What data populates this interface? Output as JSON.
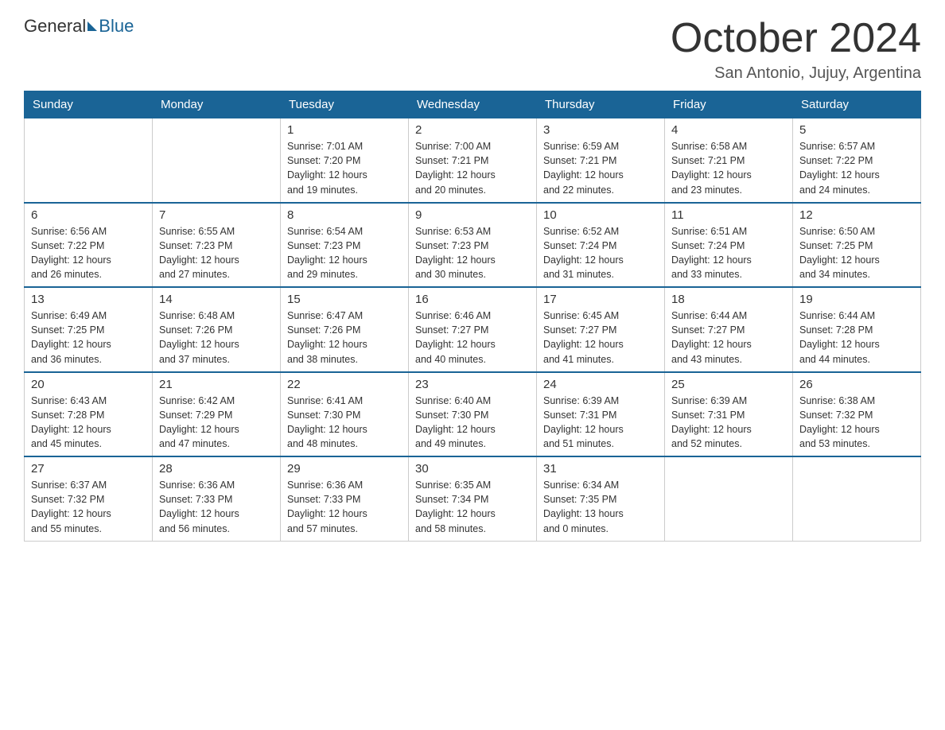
{
  "header": {
    "logo_general": "General",
    "logo_blue": "Blue",
    "month_title": "October 2024",
    "location": "San Antonio, Jujuy, Argentina"
  },
  "weekdays": [
    "Sunday",
    "Monday",
    "Tuesday",
    "Wednesday",
    "Thursday",
    "Friday",
    "Saturday"
  ],
  "weeks": [
    [
      {
        "day": "",
        "info": ""
      },
      {
        "day": "",
        "info": ""
      },
      {
        "day": "1",
        "info": "Sunrise: 7:01 AM\nSunset: 7:20 PM\nDaylight: 12 hours\nand 19 minutes."
      },
      {
        "day": "2",
        "info": "Sunrise: 7:00 AM\nSunset: 7:21 PM\nDaylight: 12 hours\nand 20 minutes."
      },
      {
        "day": "3",
        "info": "Sunrise: 6:59 AM\nSunset: 7:21 PM\nDaylight: 12 hours\nand 22 minutes."
      },
      {
        "day": "4",
        "info": "Sunrise: 6:58 AM\nSunset: 7:21 PM\nDaylight: 12 hours\nand 23 minutes."
      },
      {
        "day": "5",
        "info": "Sunrise: 6:57 AM\nSunset: 7:22 PM\nDaylight: 12 hours\nand 24 minutes."
      }
    ],
    [
      {
        "day": "6",
        "info": "Sunrise: 6:56 AM\nSunset: 7:22 PM\nDaylight: 12 hours\nand 26 minutes."
      },
      {
        "day": "7",
        "info": "Sunrise: 6:55 AM\nSunset: 7:23 PM\nDaylight: 12 hours\nand 27 minutes."
      },
      {
        "day": "8",
        "info": "Sunrise: 6:54 AM\nSunset: 7:23 PM\nDaylight: 12 hours\nand 29 minutes."
      },
      {
        "day": "9",
        "info": "Sunrise: 6:53 AM\nSunset: 7:23 PM\nDaylight: 12 hours\nand 30 minutes."
      },
      {
        "day": "10",
        "info": "Sunrise: 6:52 AM\nSunset: 7:24 PM\nDaylight: 12 hours\nand 31 minutes."
      },
      {
        "day": "11",
        "info": "Sunrise: 6:51 AM\nSunset: 7:24 PM\nDaylight: 12 hours\nand 33 minutes."
      },
      {
        "day": "12",
        "info": "Sunrise: 6:50 AM\nSunset: 7:25 PM\nDaylight: 12 hours\nand 34 minutes."
      }
    ],
    [
      {
        "day": "13",
        "info": "Sunrise: 6:49 AM\nSunset: 7:25 PM\nDaylight: 12 hours\nand 36 minutes."
      },
      {
        "day": "14",
        "info": "Sunrise: 6:48 AM\nSunset: 7:26 PM\nDaylight: 12 hours\nand 37 minutes."
      },
      {
        "day": "15",
        "info": "Sunrise: 6:47 AM\nSunset: 7:26 PM\nDaylight: 12 hours\nand 38 minutes."
      },
      {
        "day": "16",
        "info": "Sunrise: 6:46 AM\nSunset: 7:27 PM\nDaylight: 12 hours\nand 40 minutes."
      },
      {
        "day": "17",
        "info": "Sunrise: 6:45 AM\nSunset: 7:27 PM\nDaylight: 12 hours\nand 41 minutes."
      },
      {
        "day": "18",
        "info": "Sunrise: 6:44 AM\nSunset: 7:27 PM\nDaylight: 12 hours\nand 43 minutes."
      },
      {
        "day": "19",
        "info": "Sunrise: 6:44 AM\nSunset: 7:28 PM\nDaylight: 12 hours\nand 44 minutes."
      }
    ],
    [
      {
        "day": "20",
        "info": "Sunrise: 6:43 AM\nSunset: 7:28 PM\nDaylight: 12 hours\nand 45 minutes."
      },
      {
        "day": "21",
        "info": "Sunrise: 6:42 AM\nSunset: 7:29 PM\nDaylight: 12 hours\nand 47 minutes."
      },
      {
        "day": "22",
        "info": "Sunrise: 6:41 AM\nSunset: 7:30 PM\nDaylight: 12 hours\nand 48 minutes."
      },
      {
        "day": "23",
        "info": "Sunrise: 6:40 AM\nSunset: 7:30 PM\nDaylight: 12 hours\nand 49 minutes."
      },
      {
        "day": "24",
        "info": "Sunrise: 6:39 AM\nSunset: 7:31 PM\nDaylight: 12 hours\nand 51 minutes."
      },
      {
        "day": "25",
        "info": "Sunrise: 6:39 AM\nSunset: 7:31 PM\nDaylight: 12 hours\nand 52 minutes."
      },
      {
        "day": "26",
        "info": "Sunrise: 6:38 AM\nSunset: 7:32 PM\nDaylight: 12 hours\nand 53 minutes."
      }
    ],
    [
      {
        "day": "27",
        "info": "Sunrise: 6:37 AM\nSunset: 7:32 PM\nDaylight: 12 hours\nand 55 minutes."
      },
      {
        "day": "28",
        "info": "Sunrise: 6:36 AM\nSunset: 7:33 PM\nDaylight: 12 hours\nand 56 minutes."
      },
      {
        "day": "29",
        "info": "Sunrise: 6:36 AM\nSunset: 7:33 PM\nDaylight: 12 hours\nand 57 minutes."
      },
      {
        "day": "30",
        "info": "Sunrise: 6:35 AM\nSunset: 7:34 PM\nDaylight: 12 hours\nand 58 minutes."
      },
      {
        "day": "31",
        "info": "Sunrise: 6:34 AM\nSunset: 7:35 PM\nDaylight: 13 hours\nand 0 minutes."
      },
      {
        "day": "",
        "info": ""
      },
      {
        "day": "",
        "info": ""
      }
    ]
  ]
}
